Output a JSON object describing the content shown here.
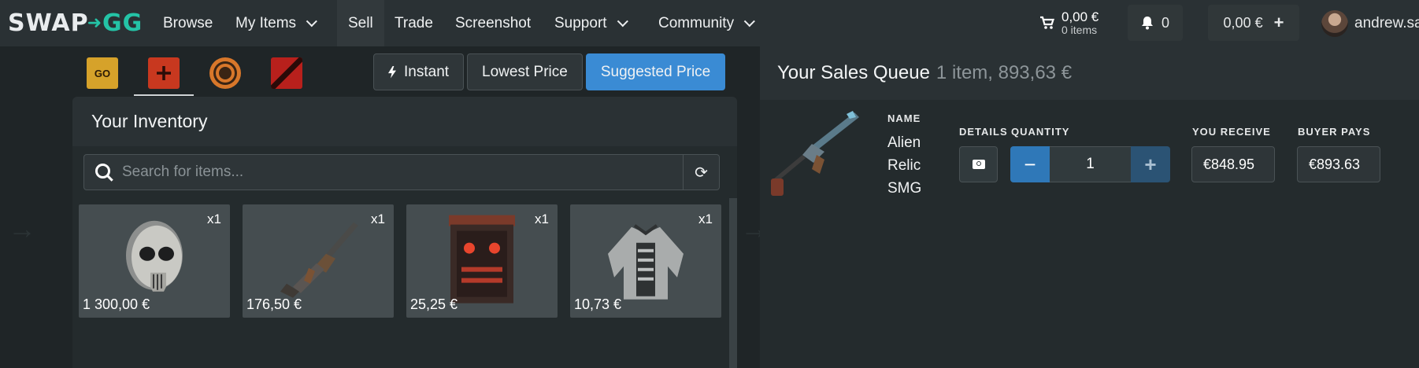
{
  "brand": {
    "logo_text": "SWAP",
    "logo_suffix": "GG"
  },
  "nav": {
    "browse": "Browse",
    "my_items": "My Items",
    "sell": "Sell",
    "trade": "Trade",
    "screenshot": "Screenshot",
    "support": "Support",
    "community": "Community"
  },
  "cart": {
    "amount": "0,00 €",
    "items": "0 items"
  },
  "notifications": {
    "count": "0"
  },
  "balance": {
    "amount": "0,00 €"
  },
  "user": {
    "name": "andrew.sa"
  },
  "game_tabs": [
    {
      "name": "csgo",
      "label": "GO",
      "active": false
    },
    {
      "name": "rust",
      "label": "",
      "active": true
    },
    {
      "name": "tf2",
      "label": "",
      "active": false
    },
    {
      "name": "dota2",
      "label": "",
      "active": false
    }
  ],
  "price_modes": {
    "instant": "Instant",
    "lowest": "Lowest Price",
    "suggested": "Suggested Price",
    "selected": "suggested"
  },
  "inventory": {
    "title": "Your Inventory",
    "search_placeholder": "Search for items...",
    "items": [
      {
        "name": "skull-mask",
        "qty": "x1",
        "price": "1 300,00 €"
      },
      {
        "name": "rifle",
        "qty": "x1",
        "price": "176,50 €"
      },
      {
        "name": "red-box",
        "qty": "x1",
        "price": "25,25 €"
      },
      {
        "name": "jacket",
        "qty": "x1",
        "price": "10,73 €"
      }
    ]
  },
  "queue": {
    "title": "Your Sales Queue",
    "summary": "1 item, 893,63 €",
    "labels": {
      "name": "NAME",
      "details": "DETAILS",
      "quantity": "QUANTITY",
      "you_receive": "YOU RECEIVE",
      "buyer_pays": "BUYER PAYS"
    },
    "item": {
      "name": "Alien Relic SMG",
      "quantity": "1",
      "you_receive": "€848.95",
      "buyer_pays": "€893.63"
    }
  },
  "colors": {
    "accent": "#3a8bd4",
    "brand_green": "#24c3a6",
    "nav_bg": "#2a3134",
    "page_bg": "#1f2527"
  }
}
